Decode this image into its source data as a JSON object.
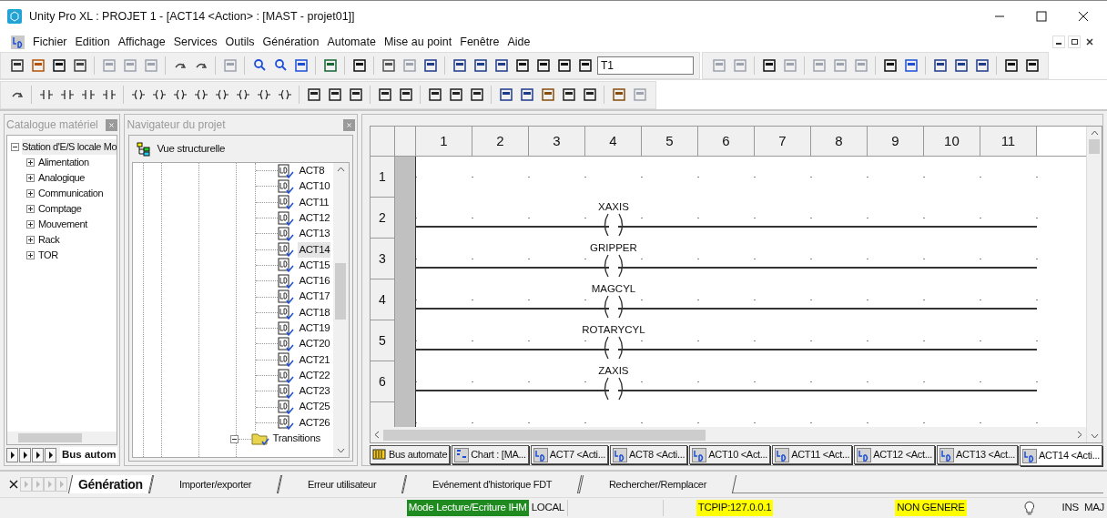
{
  "window": {
    "title": "Unity Pro XL : PROJET 1 - [ACT14 <Action> : [MAST - projet01]]"
  },
  "menu": [
    "Fichier",
    "Edition",
    "Affichage",
    "Services",
    "Outils",
    "Génération",
    "Automate",
    "Mise au point",
    "Fenêtre",
    "Aide"
  ],
  "toolbar": {
    "combo_value": "T1"
  },
  "catalogue": {
    "title": "Catalogue matériel",
    "root": {
      "label": "Station d'E/S locale Mo",
      "expanded": true,
      "selected": true,
      "children": [
        {
          "label": "Alimentation",
          "expanded": false
        },
        {
          "label": "Analogique",
          "expanded": false
        },
        {
          "label": "Communication",
          "expanded": false
        },
        {
          "label": "Comptage",
          "expanded": false
        },
        {
          "label": "Mouvement",
          "expanded": false
        },
        {
          "label": "Rack",
          "expanded": false
        },
        {
          "label": "TOR",
          "expanded": false
        }
      ]
    },
    "tab": "Bus autom"
  },
  "navigator": {
    "title": "Navigateur du projet",
    "view": "Vue structurelle",
    "items": [
      {
        "label": "ACT8",
        "selected": false
      },
      {
        "label": "ACT10",
        "selected": false
      },
      {
        "label": "ACT11",
        "selected": false
      },
      {
        "label": "ACT12",
        "selected": false
      },
      {
        "label": "ACT13",
        "selected": false
      },
      {
        "label": "ACT14",
        "selected": true
      },
      {
        "label": "ACT15",
        "selected": false
      },
      {
        "label": "ACT16",
        "selected": false
      },
      {
        "label": "ACT17",
        "selected": false
      },
      {
        "label": "ACT18",
        "selected": false
      },
      {
        "label": "ACT19",
        "selected": false
      },
      {
        "label": "ACT20",
        "selected": false
      },
      {
        "label": "ACT21",
        "selected": false
      },
      {
        "label": "ACT22",
        "selected": false
      },
      {
        "label": "ACT23",
        "selected": false
      },
      {
        "label": "ACT25",
        "selected": false
      },
      {
        "label": "ACT26",
        "selected": false
      }
    ],
    "folder": {
      "label": "Transitions",
      "expanded": true
    }
  },
  "editor": {
    "columns": [
      "1",
      "2",
      "3",
      "4",
      "5",
      "6",
      "7",
      "8",
      "9",
      "10",
      "11"
    ],
    "rows": [
      {
        "label": "1"
      },
      {
        "label": "2",
        "coil": "XAXIS"
      },
      {
        "label": "3",
        "coil": "GRIPPER"
      },
      {
        "label": "4",
        "coil": "MAGCYL"
      },
      {
        "label": "5",
        "coil": "ROTARYCYL"
      },
      {
        "label": "6",
        "coil": "ZAXIS"
      }
    ]
  },
  "doc_tabs": [
    {
      "label": "Bus automate",
      "kind": "hardware",
      "selected": false
    },
    {
      "label": "Chart : [MA...",
      "kind": "sfc",
      "selected": false
    },
    {
      "label": "ACT7 <Acti...",
      "kind": "ld",
      "selected": false
    },
    {
      "label": "ACT8 <Acti...",
      "kind": "ld",
      "selected": false
    },
    {
      "label": "ACT10 <Act...",
      "kind": "ld",
      "selected": false
    },
    {
      "label": "ACT11 <Act...",
      "kind": "ld",
      "selected": false
    },
    {
      "label": "ACT12 <Act...",
      "kind": "ld",
      "selected": false
    },
    {
      "label": "ACT13 <Act...",
      "kind": "ld",
      "selected": false
    },
    {
      "label": "ACT14 <Acti...",
      "kind": "ld",
      "selected": true
    }
  ],
  "output_tabs": [
    {
      "label": "Génération",
      "selected": true
    },
    {
      "label": "Importer/exporter",
      "selected": false
    },
    {
      "label": "Erreur utilisateur",
      "selected": false
    },
    {
      "label": "Evénement d'historique FDT",
      "selected": false
    },
    {
      "label": "Rechercher/Remplacer",
      "selected": false
    }
  ],
  "status": {
    "mode": "Mode Lecture/Ecriture IHM",
    "location": "LOCAL",
    "address": "TCPIP:127.0.0.1",
    "build": "NON GENERE",
    "ins": "INS",
    "caps": "MAJ"
  }
}
